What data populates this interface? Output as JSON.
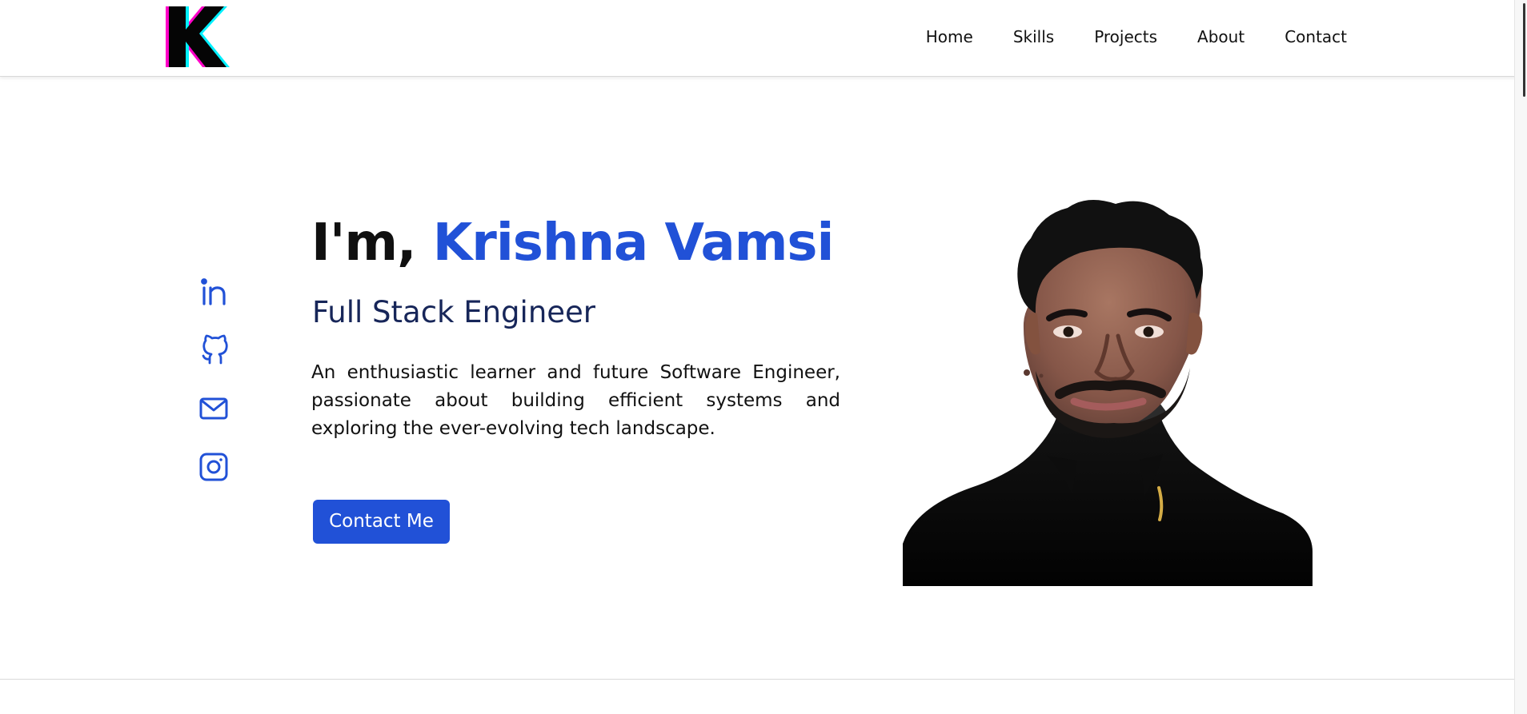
{
  "nav": {
    "items": [
      {
        "label": "Home"
      },
      {
        "label": "Skills"
      },
      {
        "label": "Projects"
      },
      {
        "label": "About"
      },
      {
        "label": "Contact"
      }
    ]
  },
  "social": {
    "icons": [
      {
        "name": "linkedin-icon"
      },
      {
        "name": "github-icon"
      },
      {
        "name": "mail-icon"
      },
      {
        "name": "instagram-icon"
      }
    ]
  },
  "hero": {
    "greeting": "I'm,",
    "name": "Krishna Vamsi",
    "role": "Full Stack Engineer",
    "bio": "An enthusiastic learner and future Software Engineer, passionate about building efficient systems and exploring the ever-evolving tech landscape.",
    "button_label": "Contact Me"
  },
  "colors": {
    "accent": "#2151d7",
    "role_text": "#172659",
    "logo_magenta": "#ff00c8",
    "logo_cyan": "#00f0ff"
  }
}
